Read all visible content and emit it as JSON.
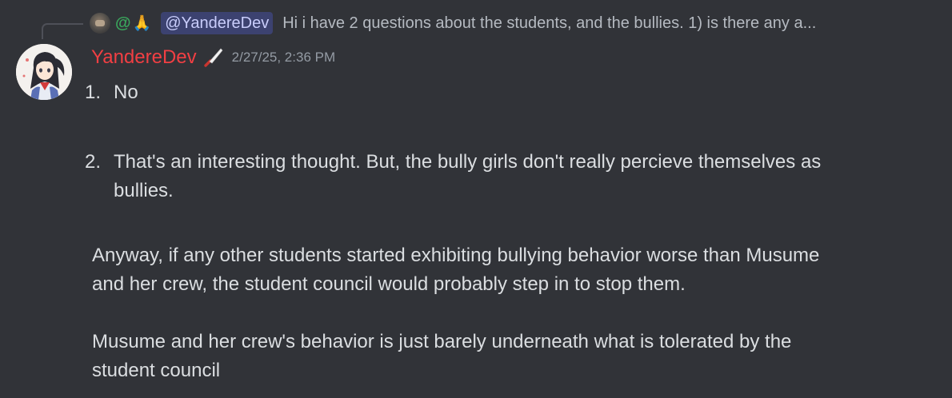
{
  "reply": {
    "at_symbol": "@",
    "emoji": "🙏",
    "mention": "@YandereDev",
    "preview_text": "Hi i have 2 questions about the students, and the bullies.  1) is there any a..."
  },
  "message": {
    "username": "YandereDev",
    "timestamp": "2/27/25, 2:36 PM",
    "list": [
      {
        "number": "1.",
        "lines": [
          "No"
        ]
      },
      {
        "number": "2.",
        "lines": [
          "That's an interesting thought. But, the bully girls don't really percieve themselves as",
          "bullies."
        ]
      }
    ],
    "paragraphs": [
      [
        "Anyway, if any other students started exhibiting bullying behavior worse than Musume",
        "and her crew, the student council would probably step in to stop them."
      ],
      [
        "Musume and her crew's behavior is just barely underneath what is tolerated by the",
        "student council"
      ]
    ]
  },
  "colors": {
    "background": "#313338",
    "username": "#f23f43",
    "mention_bg": "#3c4270",
    "mention_text": "#c9cdfb",
    "body_text": "#dbdee1",
    "muted_text": "#949ba4"
  },
  "icons": {
    "reply_avatar": "replied-user-avatar",
    "role": "knife-icon"
  }
}
